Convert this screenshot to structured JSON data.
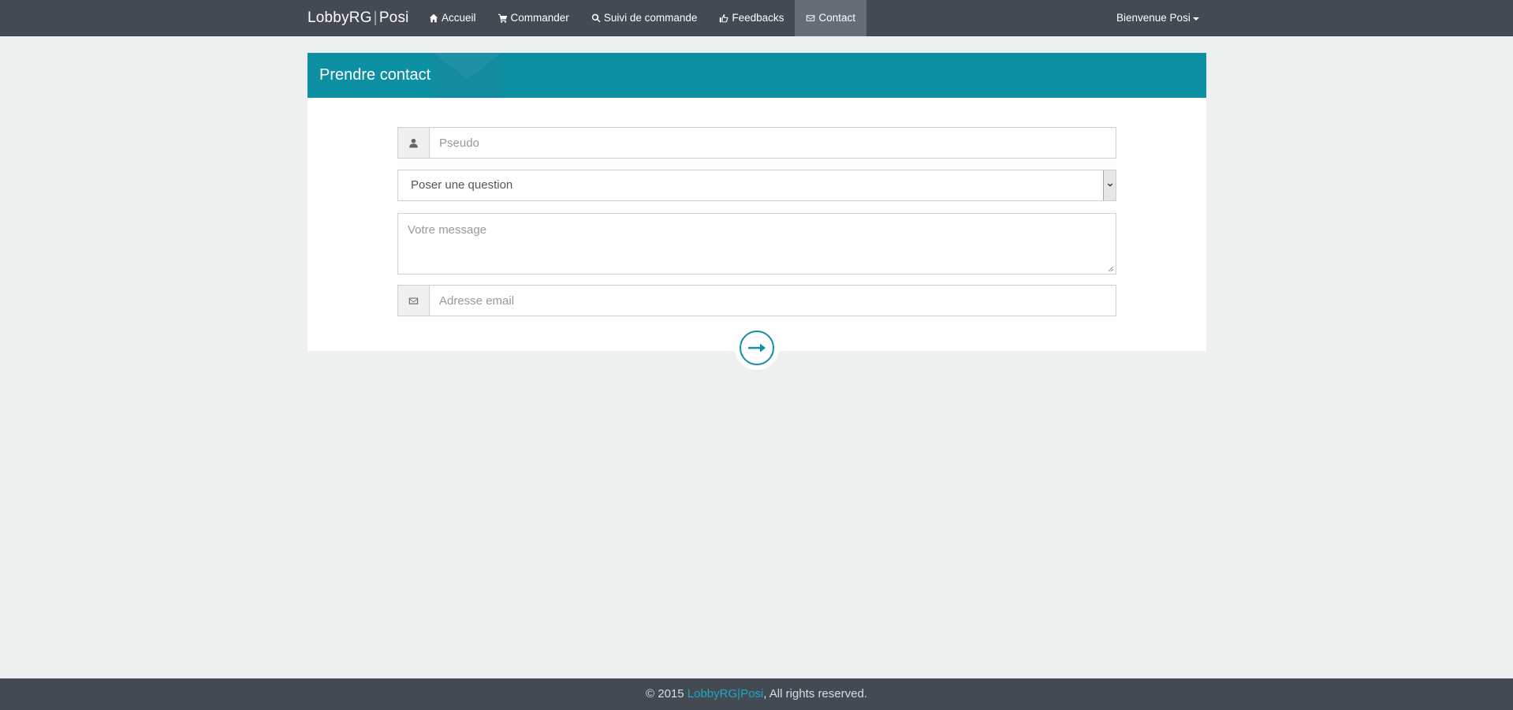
{
  "navbar": {
    "brand_left": "LobbyRG",
    "brand_sep": "|",
    "brand_right": "Posi",
    "items": [
      {
        "label": "Accueil",
        "icon": "home-icon"
      },
      {
        "label": "Commander",
        "icon": "cart-icon"
      },
      {
        "label": "Suivi de commande",
        "icon": "search-icon"
      },
      {
        "label": "Feedbacks",
        "icon": "thumbs-up-icon"
      },
      {
        "label": "Contact",
        "icon": "envelope-icon",
        "active": true
      }
    ],
    "user_greeting": "Bienvenue Posi"
  },
  "panel": {
    "title": "Prendre contact"
  },
  "form": {
    "pseudo_placeholder": "Pseudo",
    "subject_selected": "Poser une question",
    "message_placeholder": "Votre message",
    "email_placeholder": "Adresse email"
  },
  "footer": {
    "prefix": "© 2015 ",
    "brand_left": "LobbyRG",
    "brand_sep": "|",
    "brand_right": "Posi",
    "suffix": ", All rights reserved."
  },
  "colors": {
    "navbar": "#434a54",
    "accent": "#0e90a4",
    "background": "#ecf0f1"
  }
}
